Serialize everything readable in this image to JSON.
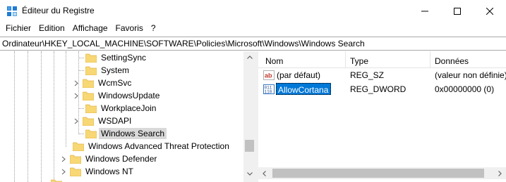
{
  "window": {
    "title": "Éditeur du Registre"
  },
  "menu": {
    "items": [
      "Fichier",
      "Edition",
      "Affichage",
      "Favoris",
      "?"
    ]
  },
  "address": {
    "path": "Ordinateur\\HKEY_LOCAL_MACHINE\\SOFTWARE\\Policies\\Microsoft\\Windows\\Windows Search"
  },
  "tree": {
    "items": [
      {
        "label": "SettingSync",
        "expandable": false,
        "selected": false
      },
      {
        "label": "System",
        "expandable": false,
        "selected": false
      },
      {
        "label": "WcmSvc",
        "expandable": true,
        "selected": false
      },
      {
        "label": "WindowsUpdate",
        "expandable": true,
        "selected": false
      },
      {
        "label": "WorkplaceJoin",
        "expandable": false,
        "selected": false
      },
      {
        "label": "WSDAPI",
        "expandable": true,
        "selected": false
      },
      {
        "label": "Windows Search",
        "expandable": false,
        "selected": true
      },
      {
        "label": "Windows Advanced Threat Protection",
        "expandable": false,
        "selected": false
      },
      {
        "label": "Windows Defender",
        "expandable": true,
        "selected": false
      },
      {
        "label": "Windows NT",
        "expandable": true,
        "selected": false
      }
    ]
  },
  "list": {
    "columns": {
      "name": "Nom",
      "type": "Type",
      "data": "Données"
    },
    "rows": [
      {
        "name": "(par défaut)",
        "type": "REG_SZ",
        "data": "(valeur non définie)",
        "icon": "string-value-icon",
        "selected": false
      },
      {
        "name": "AllowCortana",
        "type": "REG_DWORD",
        "data": "0x00000000 (0)",
        "icon": "dword-value-icon",
        "selected": true
      }
    ]
  },
  "colors": {
    "selection": "#0078d7",
    "tree_selection": "#d9d9d9",
    "folder": "#f8d775"
  }
}
